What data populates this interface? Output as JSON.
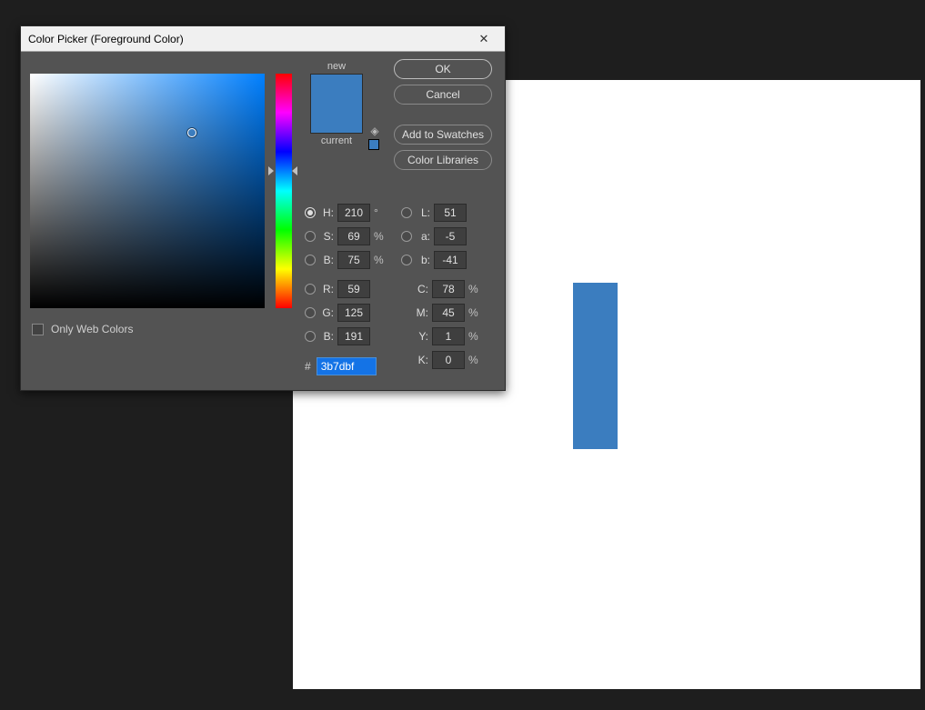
{
  "dialog": {
    "title": "Color Picker (Foreground Color)",
    "close": "✕"
  },
  "swatch": {
    "new_label": "new",
    "current_label": "current",
    "new_color": "#3b7dbf",
    "current_color": "#3b7dbf"
  },
  "buttons": {
    "ok": "OK",
    "cancel": "Cancel",
    "add_swatches": "Add to Swatches",
    "color_libraries": "Color Libraries"
  },
  "only_web": "Only Web Colors",
  "hsb": {
    "h_label": "H:",
    "h_value": "210",
    "h_unit": "°",
    "s_label": "S:",
    "s_value": "69",
    "s_unit": "%",
    "b_label": "B:",
    "b_value": "75",
    "b_unit": "%"
  },
  "lab": {
    "l_label": "L:",
    "l_value": "51",
    "a_label": "a:",
    "a_value": "-5",
    "b_label": "b:",
    "b_value": "-41"
  },
  "rgb": {
    "r_label": "R:",
    "r_value": "59",
    "g_label": "G:",
    "g_value": "125",
    "b_label": "B:",
    "b_value": "191"
  },
  "cmyk": {
    "c_label": "C:",
    "c_value": "78",
    "c_unit": "%",
    "m_label": "M:",
    "m_value": "45",
    "m_unit": "%",
    "y_label": "Y:",
    "y_value": "1",
    "y_unit": "%",
    "k_label": "K:",
    "k_value": "0",
    "k_unit": "%"
  },
  "hex": {
    "label": "#",
    "value": "3b7dbf"
  },
  "canvas": {
    "rect_color": "#3b7dbf"
  }
}
